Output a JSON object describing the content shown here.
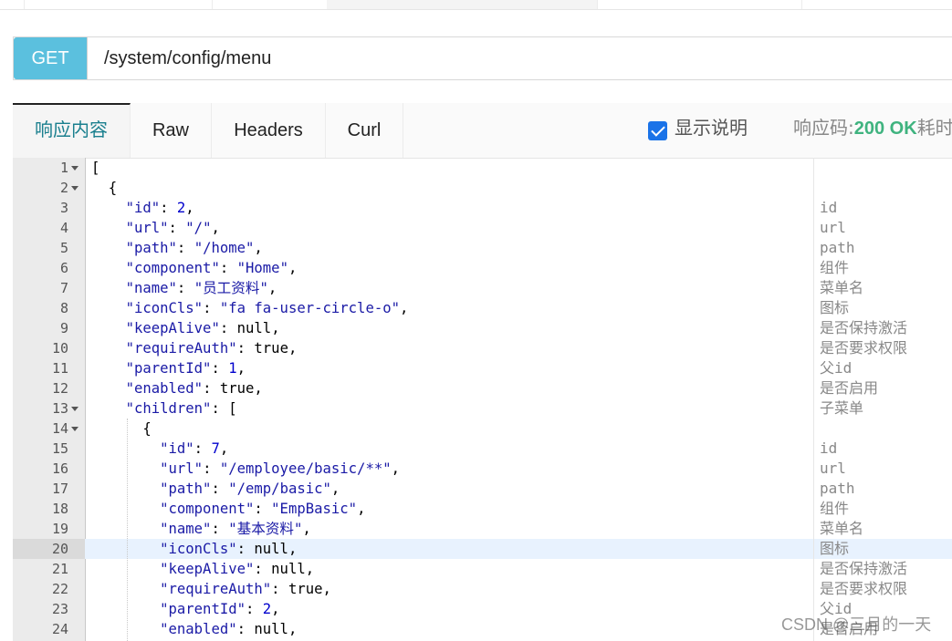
{
  "request": {
    "method": "GET",
    "url": "/system/config/menu"
  },
  "tabs": [
    {
      "label": "响应内容",
      "active": true
    },
    {
      "label": "Raw",
      "active": false
    },
    {
      "label": "Headers",
      "active": false
    },
    {
      "label": "Curl",
      "active": false
    }
  ],
  "toolbar": {
    "show_desc_label": "显示说明",
    "show_desc_checked": true,
    "status_label": "响应码:",
    "status_code": "200 OK",
    "time_label": "耗时"
  },
  "editor": {
    "active_line": 20,
    "lines": [
      {
        "no": "1",
        "fold": true,
        "indent": "",
        "key": "",
        "value": "",
        "vtype": "",
        "tail": "[",
        "note": ""
      },
      {
        "no": "2",
        "fold": true,
        "indent": "  ",
        "key": "",
        "value": "",
        "vtype": "",
        "tail": "{",
        "note": ""
      },
      {
        "no": "3",
        "fold": false,
        "indent": "    ",
        "key": "\"id\"",
        "value": "2",
        "vtype": "n",
        "tail": ",",
        "note": "id"
      },
      {
        "no": "4",
        "fold": false,
        "indent": "    ",
        "key": "\"url\"",
        "value": "\"/\"",
        "vtype": "s",
        "tail": ",",
        "note": "url"
      },
      {
        "no": "5",
        "fold": false,
        "indent": "    ",
        "key": "\"path\"",
        "value": "\"/home\"",
        "vtype": "s",
        "tail": ",",
        "note": "path"
      },
      {
        "no": "6",
        "fold": false,
        "indent": "    ",
        "key": "\"component\"",
        "value": "\"Home\"",
        "vtype": "s",
        "tail": ",",
        "note": "组件"
      },
      {
        "no": "7",
        "fold": false,
        "indent": "    ",
        "key": "\"name\"",
        "value": "\"员工资料\"",
        "vtype": "s",
        "tail": ",",
        "note": "菜单名"
      },
      {
        "no": "8",
        "fold": false,
        "indent": "    ",
        "key": "\"iconCls\"",
        "value": "\"fa fa-user-circle-o\"",
        "vtype": "s",
        "tail": ",",
        "note": "图标"
      },
      {
        "no": "9",
        "fold": false,
        "indent": "    ",
        "key": "\"keepAlive\"",
        "value": "null",
        "vtype": "p",
        "tail": ",",
        "note": "是否保持激活"
      },
      {
        "no": "10",
        "fold": false,
        "indent": "    ",
        "key": "\"requireAuth\"",
        "value": "true",
        "vtype": "p",
        "tail": ",",
        "note": "是否要求权限"
      },
      {
        "no": "11",
        "fold": false,
        "indent": "    ",
        "key": "\"parentId\"",
        "value": "1",
        "vtype": "n",
        "tail": ",",
        "note": "父id"
      },
      {
        "no": "12",
        "fold": false,
        "indent": "    ",
        "key": "\"enabled\"",
        "value": "true",
        "vtype": "p",
        "tail": ",",
        "note": "是否启用"
      },
      {
        "no": "13",
        "fold": true,
        "indent": "    ",
        "key": "\"children\"",
        "value": "[",
        "vtype": "p",
        "tail": "",
        "note": "子菜单"
      },
      {
        "no": "14",
        "fold": true,
        "indent": "      ",
        "key": "",
        "value": "",
        "vtype": "",
        "tail": "{",
        "note": ""
      },
      {
        "no": "15",
        "fold": false,
        "indent": "        ",
        "key": "\"id\"",
        "value": "7",
        "vtype": "n",
        "tail": ",",
        "note": "id"
      },
      {
        "no": "16",
        "fold": false,
        "indent": "        ",
        "key": "\"url\"",
        "value": "\"/employee/basic/**\"",
        "vtype": "s",
        "tail": ",",
        "note": "url"
      },
      {
        "no": "17",
        "fold": false,
        "indent": "        ",
        "key": "\"path\"",
        "value": "\"/emp/basic\"",
        "vtype": "s",
        "tail": ",",
        "note": "path"
      },
      {
        "no": "18",
        "fold": false,
        "indent": "        ",
        "key": "\"component\"",
        "value": "\"EmpBasic\"",
        "vtype": "s",
        "tail": ",",
        "note": "组件"
      },
      {
        "no": "19",
        "fold": false,
        "indent": "        ",
        "key": "\"name\"",
        "value": "\"基本资料\"",
        "vtype": "s",
        "tail": ",",
        "note": "菜单名"
      },
      {
        "no": "20",
        "fold": false,
        "indent": "        ",
        "key": "\"iconCls\"",
        "value": "null",
        "vtype": "p",
        "tail": ",",
        "note": "图标"
      },
      {
        "no": "21",
        "fold": false,
        "indent": "        ",
        "key": "\"keepAlive\"",
        "value": "null",
        "vtype": "p",
        "tail": ",",
        "note": "是否保持激活"
      },
      {
        "no": "22",
        "fold": false,
        "indent": "        ",
        "key": "\"requireAuth\"",
        "value": "true",
        "vtype": "p",
        "tail": ",",
        "note": "是否要求权限"
      },
      {
        "no": "23",
        "fold": false,
        "indent": "        ",
        "key": "\"parentId\"",
        "value": "2",
        "vtype": "n",
        "tail": ",",
        "note": "父id"
      },
      {
        "no": "24",
        "fold": false,
        "indent": "        ",
        "key": "\"enabled\"",
        "value": "null",
        "vtype": "p",
        "tail": ",",
        "note": "是否启用"
      }
    ]
  },
  "watermark": "CSDN @三月的一天"
}
